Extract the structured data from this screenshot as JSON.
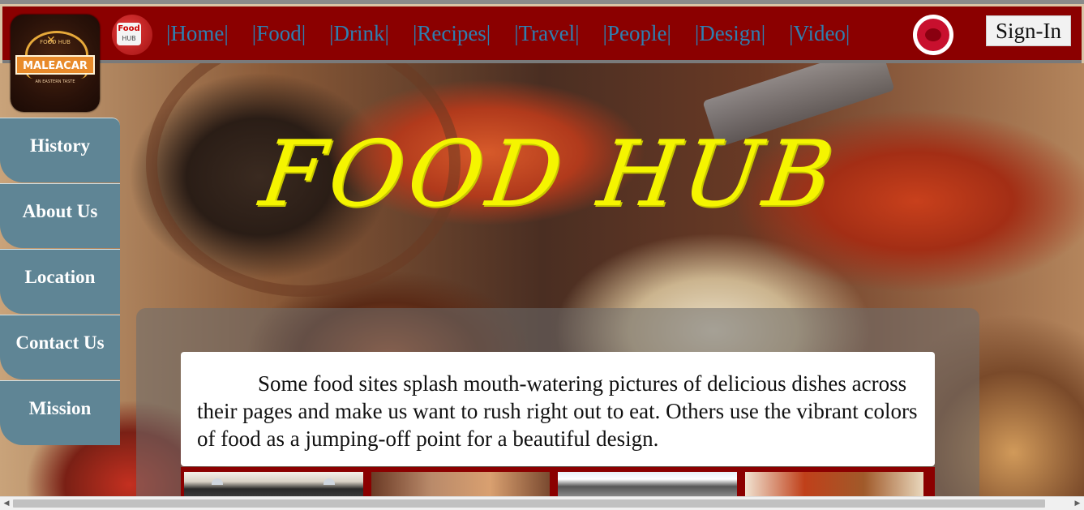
{
  "brand": {
    "logo_title": "MALEACAR",
    "logo_top": "FOOD HUB",
    "logo_tagline": "AN EASTERN TASTE",
    "icon_title": "Food",
    "icon_sub": "HUB"
  },
  "nav": {
    "links": [
      "|Home|",
      "|Food|",
      "|Drink|",
      "|Recipes|",
      "|Travel|",
      "|People|",
      "|Design|",
      "|Video|"
    ],
    "signin_label": "Sign-In"
  },
  "sidebar": {
    "items": [
      "History",
      "About Us",
      "Location",
      "Contact Us",
      "Mission"
    ]
  },
  "hero": {
    "title": "FOOD HUB",
    "intro": "Some food sites splash mouth-watering pictures of delicious dishes across their pages and make us want to rush right out to eat. Others use the vibrant colors of food as a jumping-off point for a beautiful design."
  },
  "colors": {
    "navbar": "#8b0000",
    "nav_link": "#2e7fb0",
    "sidebar": "#5f8595",
    "title": "#f5f500"
  },
  "icons": [
    "foodhub-app-icon",
    "plate-icon",
    "fork-knife-icon"
  ]
}
